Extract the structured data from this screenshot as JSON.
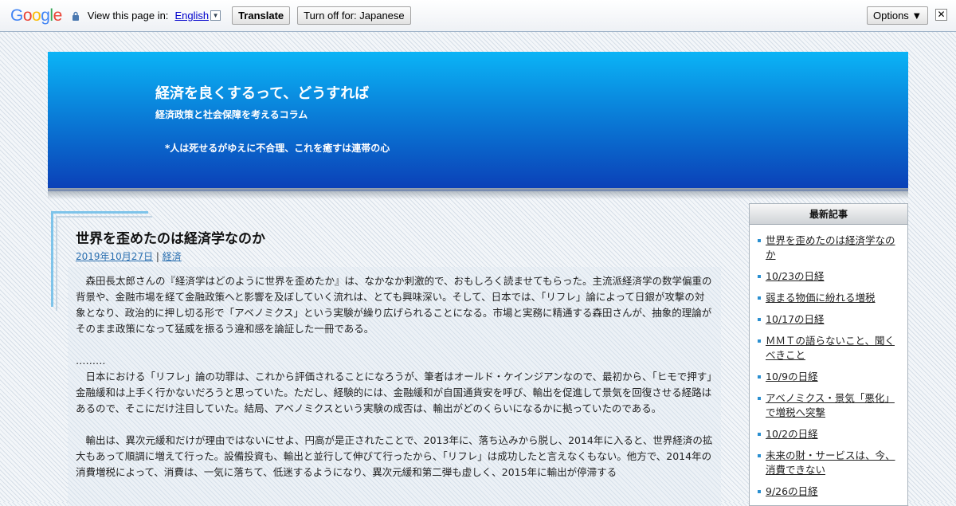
{
  "translate_bar": {
    "logo": "Google",
    "logo_colors": [
      "#4285f4",
      "#ea4335",
      "#fbbc05",
      "#4285f4",
      "#34a853",
      "#ea4335"
    ],
    "label": "View this page in:",
    "language": "English",
    "translate_button": "Translate",
    "turn_off_button": "Turn off for: Japanese",
    "options_button": "Options ▼",
    "close_glyph": "✕"
  },
  "header": {
    "title": "経済を良くするって、どうすれば",
    "description": "経済政策と社会保障を考えるコラム",
    "motto": "*人は死せるがゆえに不合理、これを癒すは連帯の心"
  },
  "entry": {
    "title": "世界を歪めたのは経済学なのか",
    "date": "2019年10月27日",
    "separator": " | ",
    "category": "経済",
    "paragraphs": [
      "森田長太郎さんの『経済学はどのように世界を歪めたか』は、なかなか刺激的で、おもしろく読ませてもらった。主流派経済学の数学偏重の背景や、金融市場を経て金融政策へと影響を及ぼしていく流れは、とても興味深い。そして、日本では、「リフレ」論によって日銀が攻撃の対象となり、政治的に押し切る形で「アベノミクス」という実験が繰り広げられることになる。市場と実務に精通する森田さんが、抽象的理論がそのまま政策になって猛威を振るう違和感を論証した一冊である。",
      "………",
      "日本における「リフレ」論の功罪は、これから評価されることになろうが、筆者はオールド・ケインジアンなので、最初から、「ヒモで押す」金融緩和は上手く行かないだろうと思っていた。ただし、経験的には、金融緩和が自国通貨安を呼び、輸出を促進して景気を回復させる経路はあるので、そこにだけ注目していた。結局、アベノミクスという実験の成否は、輸出がどのくらいになるかに拠っていたのである。",
      "輸出は、異次元緩和だけが理由ではないにせよ、円高が是正されたことで、2013年に、落ち込みから脱し、2014年に入ると、世界経済の拡大もあって順調に増えて行った。設備投資も、輸出と並行して伸びて行ったから、「リフレ」は成功したと言えなくもない。他方で、2014年の消費増税によって、消費は、一気に落ちて、低迷するようになり、異次元緩和第二弾も虚しく、2015年に輸出が停滞する"
    ]
  },
  "sidebar": {
    "heading": "最新記事",
    "items": [
      "世界を歪めたのは経済学なのか",
      "10/23の日経",
      "弱まる物価に紛れる増税",
      "10/17の日経",
      "ＭＭＴの語らないこと、聞くべきこと",
      "10/9の日経",
      "アベノミクス・景気「悪化」で増税へ突撃",
      "10/2の日経",
      "未来の財・サービスは、今、消費できない",
      "9/26の日経"
    ]
  }
}
